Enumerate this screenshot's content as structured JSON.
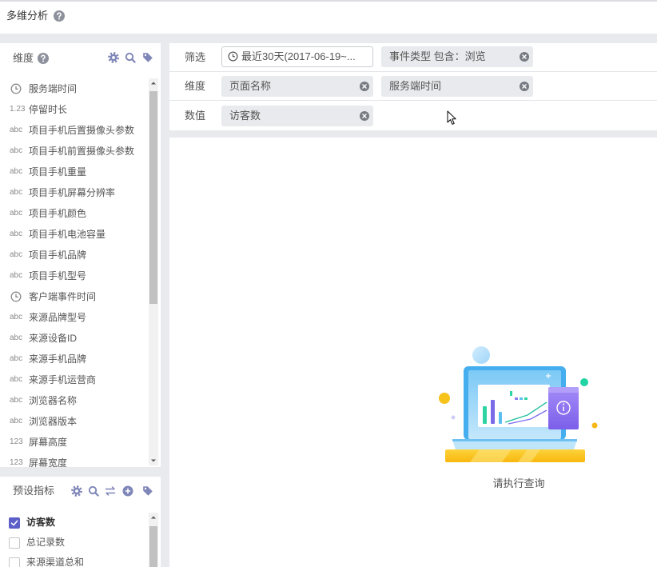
{
  "app": {
    "title": "多维分析",
    "help_icon": "question-icon"
  },
  "colors": {
    "accent": "#5b5fc7",
    "tool_icon": "#7f86b8",
    "chip_bg": "#e8eaed",
    "page_bg": "#e8eaee"
  },
  "dimensions": {
    "title": "维度",
    "toolbar_icons": [
      "gear-icon",
      "search-icon",
      "tag-icon"
    ],
    "items": [
      {
        "icon": "clock-icon",
        "label": "服务端时间"
      },
      {
        "type": "1.23",
        "label": "停留时长"
      },
      {
        "type": "abc",
        "label": "项目手机后置摄像头参数"
      },
      {
        "type": "abc",
        "label": "项目手机前置摄像头参数"
      },
      {
        "type": "abc",
        "label": "项目手机重量"
      },
      {
        "type": "abc",
        "label": "项目手机屏幕分辨率"
      },
      {
        "type": "abc",
        "label": "项目手机颜色"
      },
      {
        "type": "abc",
        "label": "项目手机电池容量"
      },
      {
        "type": "abc",
        "label": "项目手机品牌"
      },
      {
        "type": "abc",
        "label": "项目手机型号"
      },
      {
        "icon": "clock-icon",
        "label": "客户端事件时间"
      },
      {
        "type": "abc",
        "label": "来源品牌型号"
      },
      {
        "type": "abc",
        "label": "来源设备ID"
      },
      {
        "type": "abc",
        "label": "来源手机品牌"
      },
      {
        "type": "abc",
        "label": "来源手机运营商"
      },
      {
        "type": "abc",
        "label": "浏览器名称"
      },
      {
        "type": "abc",
        "label": "浏览器版本"
      },
      {
        "type": "123",
        "label": "屏幕高度"
      },
      {
        "type": "123",
        "label": "屏幕宽度"
      }
    ]
  },
  "metrics": {
    "title": "预设指标",
    "toolbar_icons": [
      "gear-icon",
      "search-icon",
      "swap-icon",
      "plus-circle-icon",
      "tag-icon"
    ],
    "items": [
      {
        "label": "访客数",
        "checked": true
      },
      {
        "label": "总记录数",
        "checked": false
      },
      {
        "label": "来源渠道总和",
        "checked": false
      }
    ]
  },
  "query": {
    "filter": {
      "label": "筛选",
      "chips": [
        {
          "icon": "clock-icon",
          "text": "最近30天(2017-06-19~..."
        },
        {
          "text": "事件类型 包含：浏览"
        }
      ]
    },
    "dimension": {
      "label": "维度",
      "chips": [
        {
          "text": "页面名称"
        },
        {
          "text": "服务端时间"
        }
      ]
    },
    "measure": {
      "label": "数值",
      "chips": [
        {
          "text": "访客数"
        }
      ]
    }
  },
  "result": {
    "empty_text": "请执行查询",
    "illustration": "laptop-chart-illustration"
  }
}
